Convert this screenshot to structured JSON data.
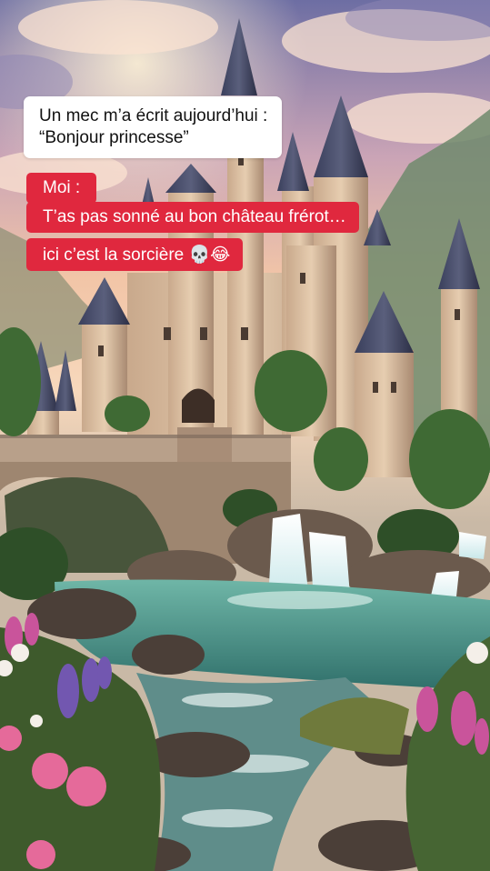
{
  "caption": {
    "line1": "Un mec m’a écrit aujourd’hui :",
    "line2": "“Bonjour princesse”"
  },
  "reply": {
    "line1": "Moi :",
    "line2": "T’as pas sonné au bon château frérot…",
    "line3_text": "ici c’est la sorcière",
    "line3_emojis": "💀😂"
  },
  "colors": {
    "caption_bg": "#ffffff",
    "reply_bg": "#e0283e",
    "reply_text": "#ffffff"
  }
}
